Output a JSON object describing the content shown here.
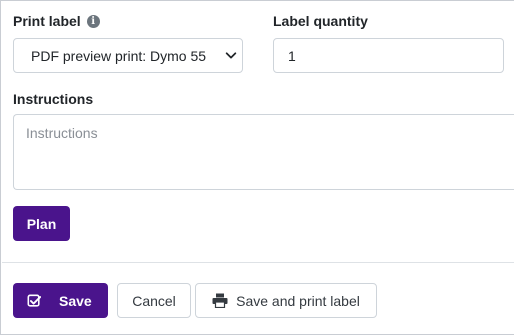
{
  "form": {
    "print_label": {
      "label": "Print label",
      "info_icon": "info-circle-icon",
      "selected_value": "PDF preview print: Dymo 55"
    },
    "label_quantity": {
      "label": "Label quantity",
      "value": "1"
    },
    "instructions": {
      "label": "Instructions",
      "placeholder": "Instructions"
    },
    "plan_button": "Plan"
  },
  "footer": {
    "save_button": {
      "label": "Save",
      "icon": "check-square-icon"
    },
    "cancel_button": {
      "label": "Cancel"
    },
    "save_print_button": {
      "label": "Save and print label",
      "icon": "printer-icon"
    }
  },
  "colors": {
    "primary": "#4a148c",
    "border": "#ced4da",
    "divider": "#dee2e6",
    "placeholder": "#8a8f96"
  }
}
